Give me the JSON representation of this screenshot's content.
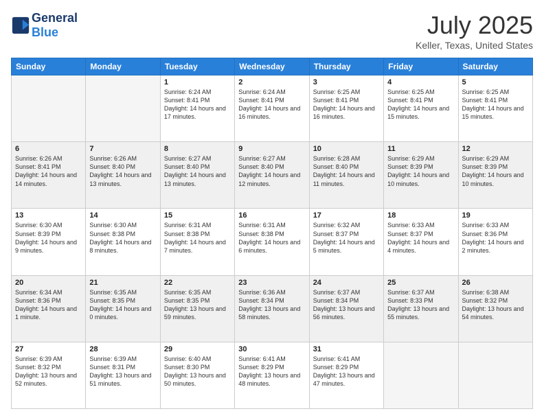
{
  "header": {
    "logo_general": "General",
    "logo_blue": "Blue",
    "title": "July 2025",
    "location": "Keller, Texas, United States"
  },
  "calendar": {
    "days_of_week": [
      "Sunday",
      "Monday",
      "Tuesday",
      "Wednesday",
      "Thursday",
      "Friday",
      "Saturday"
    ],
    "weeks": [
      [
        {
          "day": "",
          "empty": true
        },
        {
          "day": "",
          "empty": true
        },
        {
          "day": "1",
          "sunrise": "Sunrise: 6:24 AM",
          "sunset": "Sunset: 8:41 PM",
          "daylight": "Daylight: 14 hours and 17 minutes."
        },
        {
          "day": "2",
          "sunrise": "Sunrise: 6:24 AM",
          "sunset": "Sunset: 8:41 PM",
          "daylight": "Daylight: 14 hours and 16 minutes."
        },
        {
          "day": "3",
          "sunrise": "Sunrise: 6:25 AM",
          "sunset": "Sunset: 8:41 PM",
          "daylight": "Daylight: 14 hours and 16 minutes."
        },
        {
          "day": "4",
          "sunrise": "Sunrise: 6:25 AM",
          "sunset": "Sunset: 8:41 PM",
          "daylight": "Daylight: 14 hours and 15 minutes."
        },
        {
          "day": "5",
          "sunrise": "Sunrise: 6:25 AM",
          "sunset": "Sunset: 8:41 PM",
          "daylight": "Daylight: 14 hours and 15 minutes."
        }
      ],
      [
        {
          "day": "6",
          "sunrise": "Sunrise: 6:26 AM",
          "sunset": "Sunset: 8:41 PM",
          "daylight": "Daylight: 14 hours and 14 minutes."
        },
        {
          "day": "7",
          "sunrise": "Sunrise: 6:26 AM",
          "sunset": "Sunset: 8:40 PM",
          "daylight": "Daylight: 14 hours and 13 minutes."
        },
        {
          "day": "8",
          "sunrise": "Sunrise: 6:27 AM",
          "sunset": "Sunset: 8:40 PM",
          "daylight": "Daylight: 14 hours and 13 minutes."
        },
        {
          "day": "9",
          "sunrise": "Sunrise: 6:27 AM",
          "sunset": "Sunset: 8:40 PM",
          "daylight": "Daylight: 14 hours and 12 minutes."
        },
        {
          "day": "10",
          "sunrise": "Sunrise: 6:28 AM",
          "sunset": "Sunset: 8:40 PM",
          "daylight": "Daylight: 14 hours and 11 minutes."
        },
        {
          "day": "11",
          "sunrise": "Sunrise: 6:29 AM",
          "sunset": "Sunset: 8:39 PM",
          "daylight": "Daylight: 14 hours and 10 minutes."
        },
        {
          "day": "12",
          "sunrise": "Sunrise: 6:29 AM",
          "sunset": "Sunset: 8:39 PM",
          "daylight": "Daylight: 14 hours and 10 minutes."
        }
      ],
      [
        {
          "day": "13",
          "sunrise": "Sunrise: 6:30 AM",
          "sunset": "Sunset: 8:39 PM",
          "daylight": "Daylight: 14 hours and 9 minutes."
        },
        {
          "day": "14",
          "sunrise": "Sunrise: 6:30 AM",
          "sunset": "Sunset: 8:38 PM",
          "daylight": "Daylight: 14 hours and 8 minutes."
        },
        {
          "day": "15",
          "sunrise": "Sunrise: 6:31 AM",
          "sunset": "Sunset: 8:38 PM",
          "daylight": "Daylight: 14 hours and 7 minutes."
        },
        {
          "day": "16",
          "sunrise": "Sunrise: 6:31 AM",
          "sunset": "Sunset: 8:38 PM",
          "daylight": "Daylight: 14 hours and 6 minutes."
        },
        {
          "day": "17",
          "sunrise": "Sunrise: 6:32 AM",
          "sunset": "Sunset: 8:37 PM",
          "daylight": "Daylight: 14 hours and 5 minutes."
        },
        {
          "day": "18",
          "sunrise": "Sunrise: 6:33 AM",
          "sunset": "Sunset: 8:37 PM",
          "daylight": "Daylight: 14 hours and 4 minutes."
        },
        {
          "day": "19",
          "sunrise": "Sunrise: 6:33 AM",
          "sunset": "Sunset: 8:36 PM",
          "daylight": "Daylight: 14 hours and 2 minutes."
        }
      ],
      [
        {
          "day": "20",
          "sunrise": "Sunrise: 6:34 AM",
          "sunset": "Sunset: 8:36 PM",
          "daylight": "Daylight: 14 hours and 1 minute."
        },
        {
          "day": "21",
          "sunrise": "Sunrise: 6:35 AM",
          "sunset": "Sunset: 8:35 PM",
          "daylight": "Daylight: 14 hours and 0 minutes."
        },
        {
          "day": "22",
          "sunrise": "Sunrise: 6:35 AM",
          "sunset": "Sunset: 8:35 PM",
          "daylight": "Daylight: 13 hours and 59 minutes."
        },
        {
          "day": "23",
          "sunrise": "Sunrise: 6:36 AM",
          "sunset": "Sunset: 8:34 PM",
          "daylight": "Daylight: 13 hours and 58 minutes."
        },
        {
          "day": "24",
          "sunrise": "Sunrise: 6:37 AM",
          "sunset": "Sunset: 8:34 PM",
          "daylight": "Daylight: 13 hours and 56 minutes."
        },
        {
          "day": "25",
          "sunrise": "Sunrise: 6:37 AM",
          "sunset": "Sunset: 8:33 PM",
          "daylight": "Daylight: 13 hours and 55 minutes."
        },
        {
          "day": "26",
          "sunrise": "Sunrise: 6:38 AM",
          "sunset": "Sunset: 8:32 PM",
          "daylight": "Daylight: 13 hours and 54 minutes."
        }
      ],
      [
        {
          "day": "27",
          "sunrise": "Sunrise: 6:39 AM",
          "sunset": "Sunset: 8:32 PM",
          "daylight": "Daylight: 13 hours and 52 minutes."
        },
        {
          "day": "28",
          "sunrise": "Sunrise: 6:39 AM",
          "sunset": "Sunset: 8:31 PM",
          "daylight": "Daylight: 13 hours and 51 minutes."
        },
        {
          "day": "29",
          "sunrise": "Sunrise: 6:40 AM",
          "sunset": "Sunset: 8:30 PM",
          "daylight": "Daylight: 13 hours and 50 minutes."
        },
        {
          "day": "30",
          "sunrise": "Sunrise: 6:41 AM",
          "sunset": "Sunset: 8:29 PM",
          "daylight": "Daylight: 13 hours and 48 minutes."
        },
        {
          "day": "31",
          "sunrise": "Sunrise: 6:41 AM",
          "sunset": "Sunset: 8:29 PM",
          "daylight": "Daylight: 13 hours and 47 minutes."
        },
        {
          "day": "",
          "empty": true
        },
        {
          "day": "",
          "empty": true
        }
      ]
    ]
  }
}
